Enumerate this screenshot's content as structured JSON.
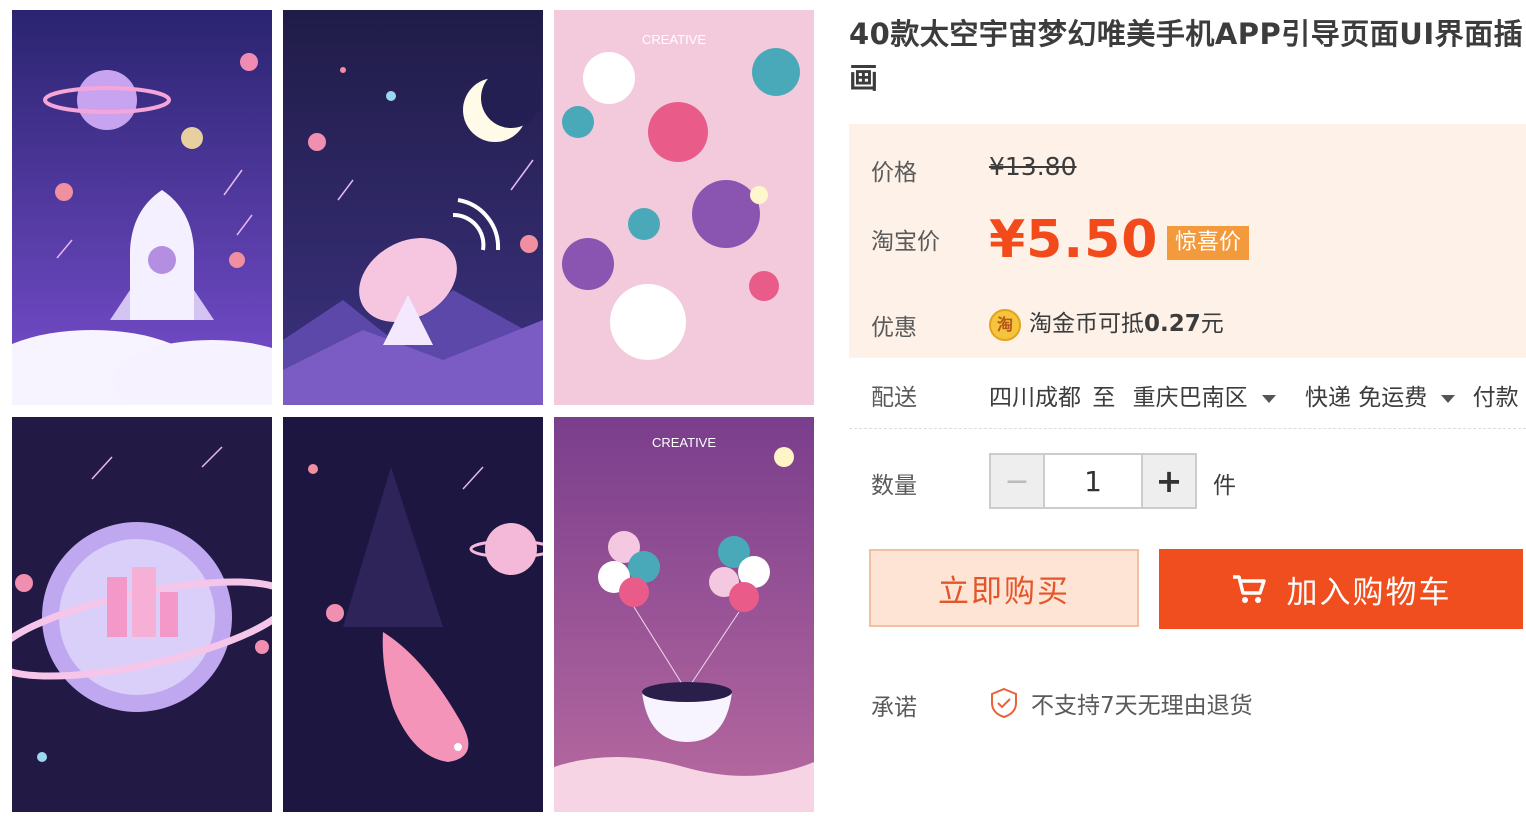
{
  "product": {
    "title": "40款太空宇宙梦幻唯美手机APP引导页面UI界面插画"
  },
  "gallery": {
    "panels": [
      "rocket-space-illustration",
      "satellite-moon-illustration",
      "pink-bubbles-illustration",
      "planet-city-illustration",
      "whale-stars-illustration",
      "balloons-girl-illustration"
    ],
    "watermark_1": "CREATIVE",
    "watermark_2": "CREATIVE"
  },
  "price": {
    "label": "价格",
    "original": "¥13.80",
    "taobao_label": "淘宝价",
    "taobao_price": "¥5.50",
    "badge": "惊喜价"
  },
  "promo": {
    "label": "优惠",
    "coin_icon_text": "淘",
    "text": "淘金币可抵",
    "amount": "0.27",
    "unit": "元"
  },
  "delivery": {
    "label": "配送",
    "from": "四川成都",
    "to_word": "至",
    "to": "重庆巴南区",
    "method": "快递 免运费",
    "payment": "付款"
  },
  "quantity": {
    "label": "数量",
    "minus": "−",
    "value": "1",
    "plus": "+",
    "unit": "件"
  },
  "actions": {
    "buy_now": "立即购买",
    "add_cart": "加入购物车"
  },
  "promise": {
    "label": "承诺",
    "text": "不支持7天无理由退货"
  },
  "colors": {
    "accent": "#f04e1e",
    "price": "#f24a1b",
    "badge": "#f39a3c",
    "price_bg": "#fdf1e8"
  }
}
